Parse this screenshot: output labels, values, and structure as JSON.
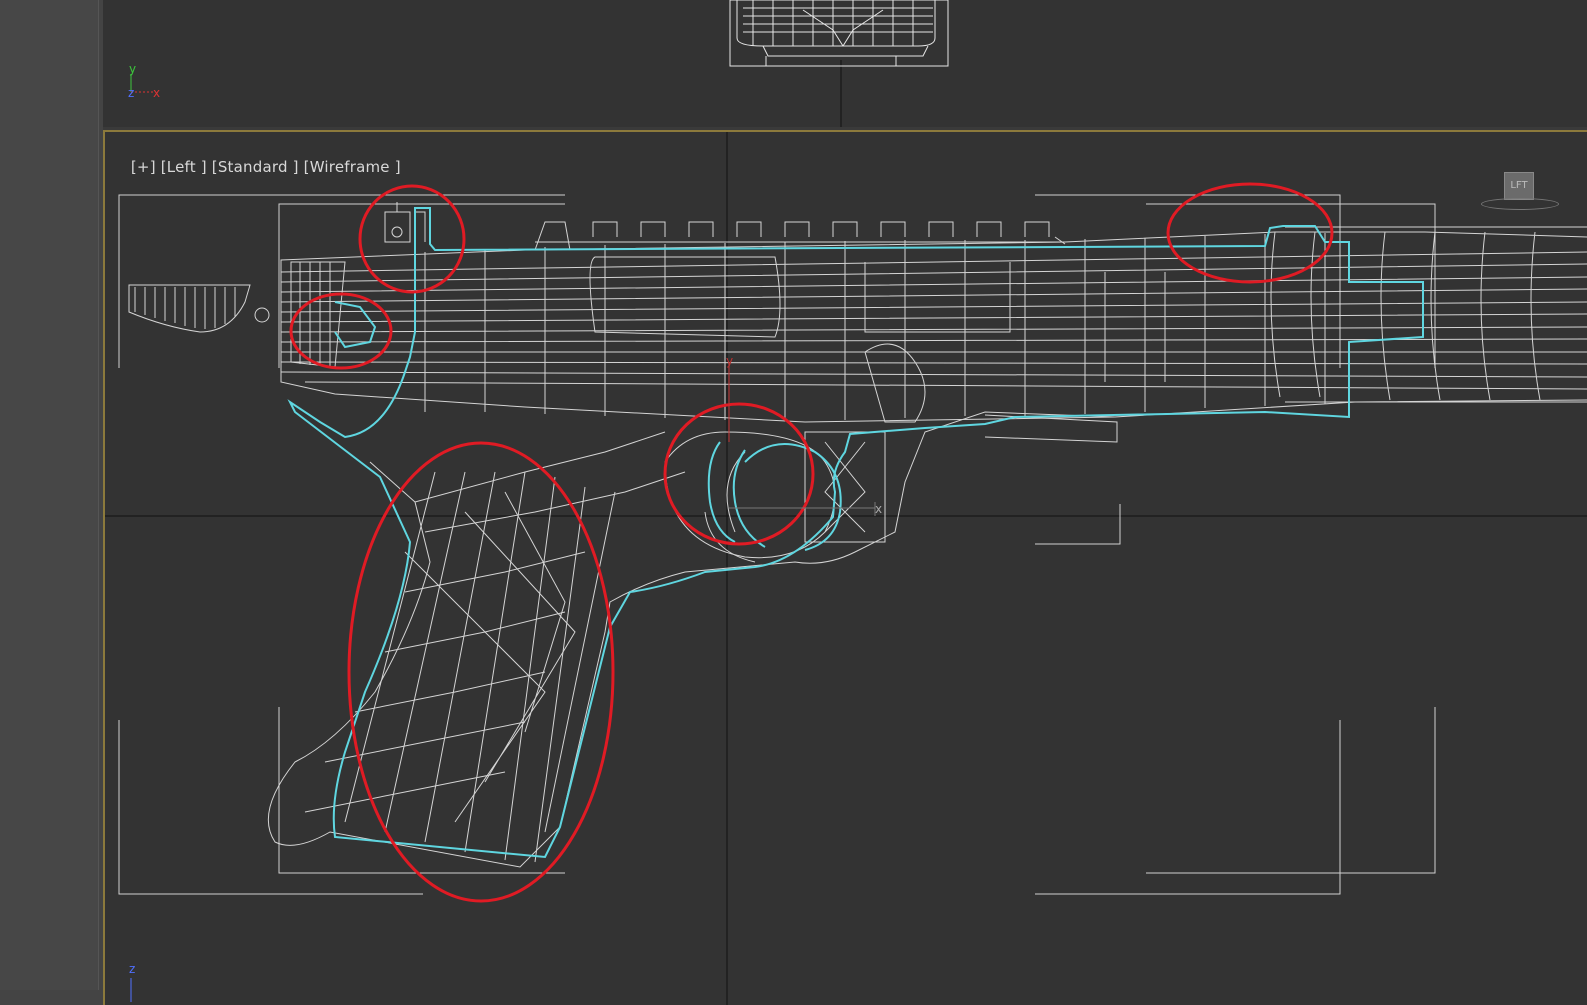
{
  "viewport_top": {
    "axes": {
      "y": "y",
      "z": "z",
      "x": "x"
    }
  },
  "viewport_left": {
    "label_plus": "[+]",
    "label_view": "[Left ]",
    "label_shading_style": "[Standard ]",
    "label_shading": "[Wireframe ]",
    "axis_z": "z",
    "gizmo_y": "y",
    "gizmo_x": "x"
  },
  "viewcube": {
    "face_label": "LFT"
  },
  "colors": {
    "wire": "#e6e6e6",
    "selection": "#5fd6e0",
    "highlight_circle": "#e01b24",
    "viewport_bg": "#333333",
    "active_border": "#8c7a3c"
  },
  "icons": [
    "axis-tripod-icon",
    "viewcube-icon",
    "gizmo-icon"
  ]
}
